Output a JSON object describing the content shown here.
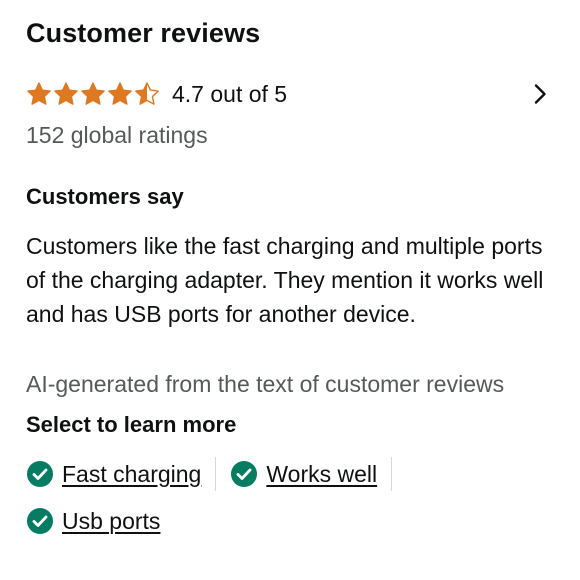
{
  "header": {
    "title": "Customer reviews"
  },
  "rating": {
    "value": 4.7,
    "text": "4.7 out of 5",
    "star_color": "#de7921",
    "star_icons": [
      "star-full-icon",
      "star-full-icon",
      "star-full-icon",
      "star-full-icon",
      "star-half-icon"
    ],
    "global_ratings": "152 global ratings"
  },
  "customers_say": {
    "heading": "Customers say",
    "summary": "Customers like the fast charging and multiple ports of the charging adapter. They mention it works well and has USB ports for another device.",
    "ai_note": "AI-generated from the text of customer reviews"
  },
  "learn_more": {
    "heading": "Select to learn more",
    "check_color": "#067d62",
    "chips": [
      {
        "label": "Fast charging"
      },
      {
        "label": "Works well"
      },
      {
        "label": "Usb ports"
      }
    ]
  }
}
